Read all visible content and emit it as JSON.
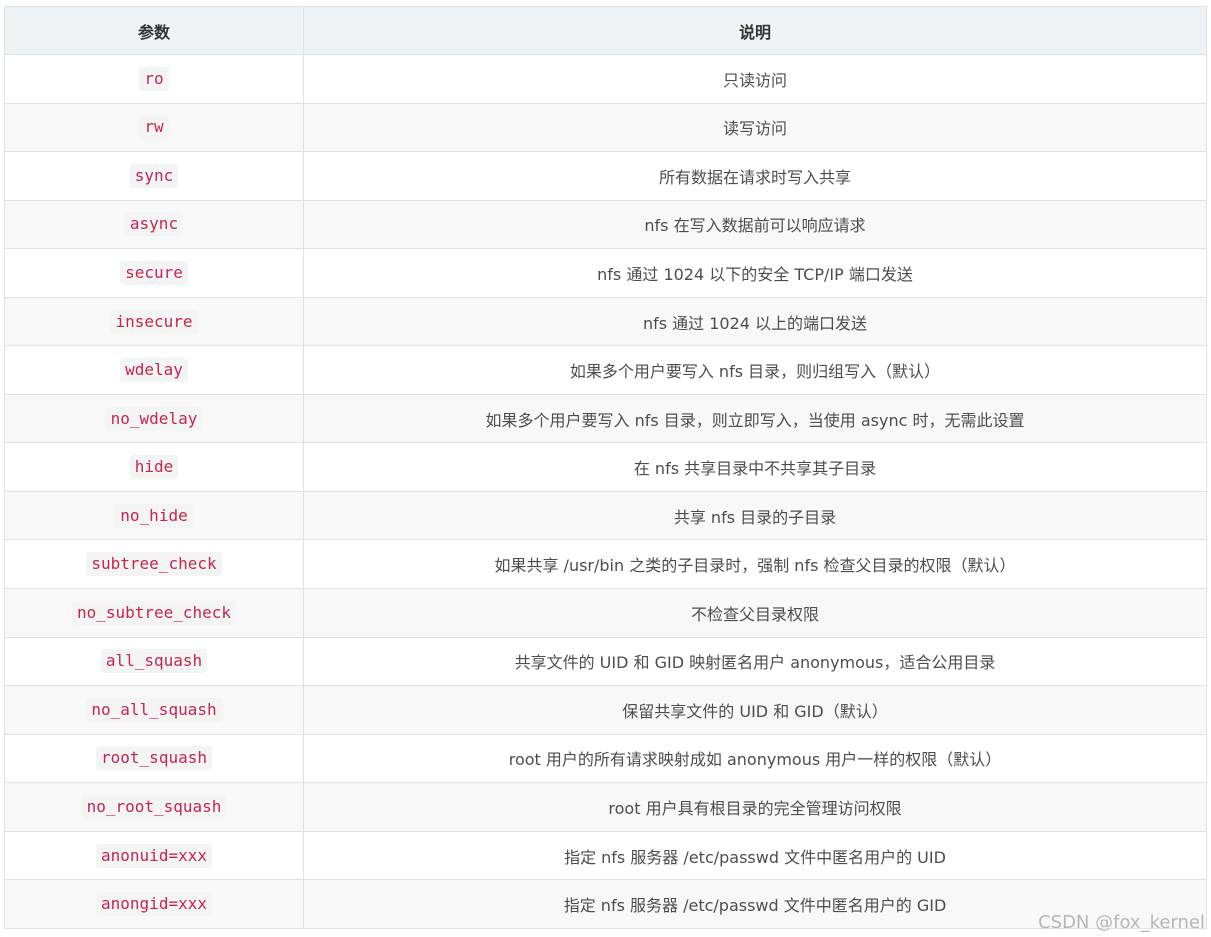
{
  "table": {
    "headers": [
      "参数",
      "说明"
    ],
    "rows": [
      {
        "param": "ro",
        "desc": "只读访问"
      },
      {
        "param": "rw",
        "desc": "读写访问"
      },
      {
        "param": "sync",
        "desc": "所有数据在请求时写入共享"
      },
      {
        "param": "async",
        "desc": "nfs 在写入数据前可以响应请求"
      },
      {
        "param": "secure",
        "desc": "nfs 通过 1024 以下的安全 TCP/IP 端口发送"
      },
      {
        "param": "insecure",
        "desc": "nfs 通过 1024 以上的端口发送"
      },
      {
        "param": "wdelay",
        "desc": "如果多个用户要写入 nfs 目录，则归组写入（默认）"
      },
      {
        "param": "no_wdelay",
        "desc": "如果多个用户要写入 nfs 目录，则立即写入，当使用 async 时，无需此设置"
      },
      {
        "param": "hide",
        "desc": "在 nfs 共享目录中不共享其子目录"
      },
      {
        "param": "no_hide",
        "desc": "共享 nfs 目录的子目录"
      },
      {
        "param": "subtree_check",
        "desc": "如果共享 /usr/bin 之类的子目录时，强制 nfs 检查父目录的权限（默认）"
      },
      {
        "param": "no_subtree_check",
        "desc": "不检查父目录权限"
      },
      {
        "param": "all_squash",
        "desc": "共享文件的 UID 和 GID 映射匿名用户 anonymous，适合公用目录"
      },
      {
        "param": "no_all_squash",
        "desc": "保留共享文件的 UID 和 GID（默认）"
      },
      {
        "param": "root_squash",
        "desc": "root 用户的所有请求映射成如 anonymous 用户一样的权限（默认）"
      },
      {
        "param": "no_root_squash",
        "desc": "root 用户具有根目录的完全管理访问权限"
      },
      {
        "param": "anonuid=xxx",
        "desc": "指定 nfs 服务器 /etc/passwd 文件中匿名用户的 UID"
      },
      {
        "param": "anongid=xxx",
        "desc": "指定 nfs 服务器 /etc/passwd 文件中匿名用户的 GID"
      }
    ]
  },
  "watermark": "CSDN @fox_kernel",
  "colors": {
    "code_text": "#c7254e",
    "code_bg": "#f3f4f4",
    "header_bg": "#eff3f5",
    "alt_row_bg": "#f8f8f8",
    "border": "#dfe2e5"
  }
}
